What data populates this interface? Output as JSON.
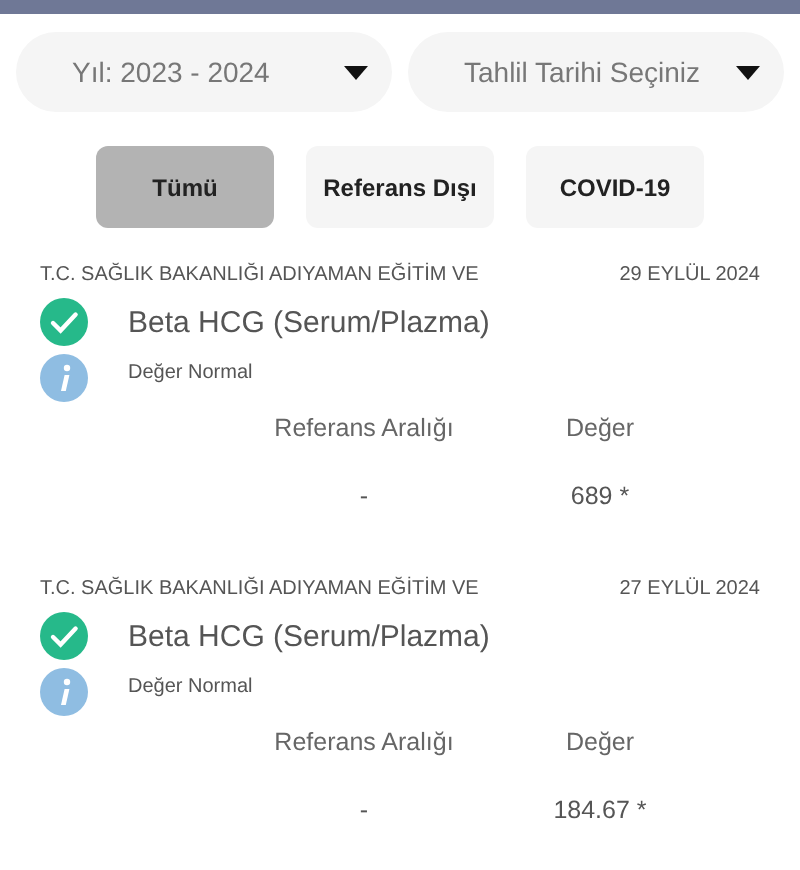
{
  "dropdowns": [
    {
      "value": "Yıl: 2023 - 2024"
    },
    {
      "placeholder": "Tahlil Tarihi Seçiniz"
    }
  ],
  "filters": [
    {
      "label": "Tümü",
      "selected": true
    },
    {
      "label": "Referans Dışı",
      "selected": false
    },
    {
      "label": "COVID-19",
      "selected": false
    }
  ],
  "results": [
    {
      "institution": "T.C. SAĞLIK BAKANLIĞI ADIYAMAN EĞİTİM VE",
      "date": "29 EYLÜL 2024",
      "test": "Beta HCG (Serum/Plazma)",
      "note": "Değer Normal",
      "columns": [
        "Referans Aralığı",
        "Değer"
      ],
      "reference": "-",
      "value": "689 *"
    },
    {
      "institution": "T.C. SAĞLIK BAKANLIĞI ADIYAMAN EĞİTİM VE",
      "date": "27 EYLÜL 2024",
      "test": "Beta HCG (Serum/Plazma)",
      "note": "Değer Normal",
      "columns": [
        "Referans Aralığı",
        "Değer"
      ],
      "reference": "-",
      "value": "184.67 *"
    }
  ]
}
